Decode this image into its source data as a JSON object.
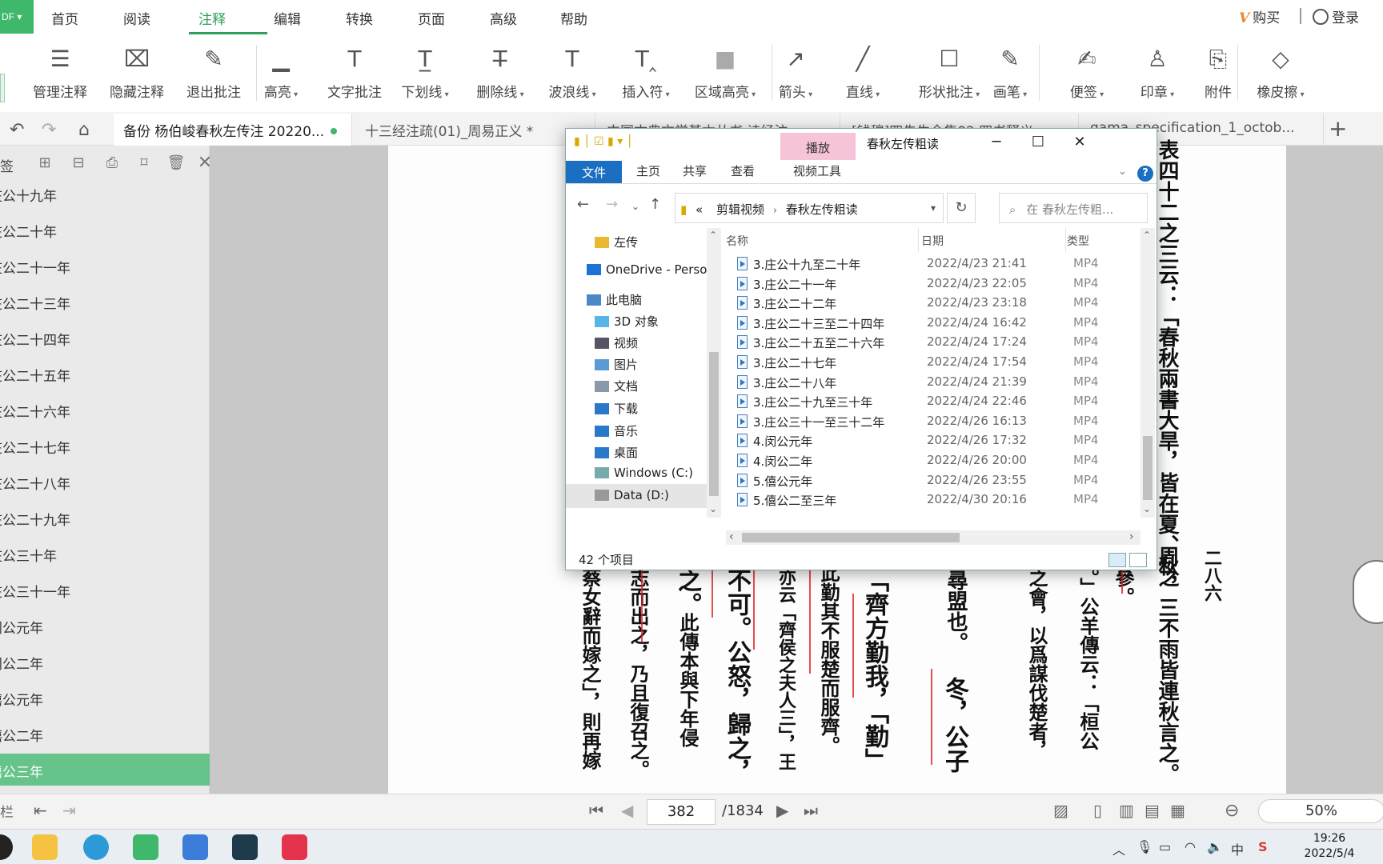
{
  "app": {
    "logo_text": "DF",
    "menu": [
      "首页",
      "阅读",
      "注释",
      "编辑",
      "转换",
      "页面",
      "高级",
      "帮助"
    ],
    "active_menu": "注释",
    "vip_label": "购买",
    "login_label": "登录"
  },
  "toolbar": {
    "items": [
      {
        "label": "管理注释",
        "caret": false,
        "icon": "manage-notes-icon"
      },
      {
        "label": "隐藏注释",
        "caret": false,
        "icon": "hide-notes-icon"
      },
      {
        "label": "退出批注",
        "caret": false,
        "icon": "exit-annotate-icon"
      },
      {
        "label": "高亮",
        "caret": true,
        "icon": "highlight-icon"
      },
      {
        "label": "文字批注",
        "caret": false,
        "icon": "text-note-icon"
      },
      {
        "label": "下划线",
        "caret": true,
        "icon": "underline-icon"
      },
      {
        "label": "删除线",
        "caret": true,
        "icon": "strikethrough-icon"
      },
      {
        "label": "波浪线",
        "caret": true,
        "icon": "wavy-line-icon"
      },
      {
        "label": "插入符",
        "caret": true,
        "icon": "caret-insert-icon"
      },
      {
        "label": "区域高亮",
        "caret": true,
        "icon": "area-highlight-icon"
      },
      {
        "label": "箭头",
        "caret": true,
        "icon": "arrow-icon"
      },
      {
        "label": "直线",
        "caret": true,
        "icon": "line-icon"
      },
      {
        "label": "形状批注",
        "caret": true,
        "icon": "shape-icon"
      },
      {
        "label": "画笔",
        "caret": true,
        "icon": "pen-icon"
      },
      {
        "label": "便签",
        "caret": true,
        "icon": "sticky-note-icon"
      },
      {
        "label": "印章",
        "caret": true,
        "icon": "stamp-icon"
      },
      {
        "label": "附件",
        "caret": false,
        "icon": "attachment-icon"
      },
      {
        "label": "橡皮擦",
        "caret": true,
        "icon": "eraser-icon"
      }
    ]
  },
  "tabs": [
    {
      "label": "备份 杨伯峻春秋左传注 20220...",
      "active": true,
      "unsaved_dot": true
    },
    {
      "label": "十三经注疏(01)_周易正义 *",
      "active": false
    },
    {
      "label": "中国古典文学基本丛书 诗经注...",
      "active": false
    },
    {
      "label": "[钱穆]四先生全集02 四书释义",
      "active": false
    },
    {
      "label": "gama_specification_1_octob...",
      "active": false
    }
  ],
  "sidebar": {
    "title": "签",
    "items": [
      "庄公十九年",
      "庄公二十年",
      "庄公二十一年",
      "庄公二十三年",
      "庄公二十四年",
      "庄公二十五年",
      "庄公二十六年",
      "庄公二十七年",
      "庄公二十八年",
      "庄公二十九年",
      "庄公三十年",
      "庄公三十一年",
      "闵公元年",
      "闵公二年",
      "僖公元年",
      "僖公二年",
      "僖公三年"
    ],
    "selected": "僖公三年"
  },
  "document": {
    "columns": [
      {
        "text": "表四十二之三云：「春秋兩書大旱，皆在夏、秋，三不雨皆連秋言之。",
        "size": 26
      },
      {
        "text": "周之",
        "size": 26
      },
      {
        "text": "二八六",
        "size": 22
      },
      {
        "text": "可參。",
        "size": 24
      },
      {
        "text": "志。」公羊傳云：「桓公",
        "size": 24
      },
      {
        "text": "殿之會，以爲謀伐楚者，",
        "size": 24
      },
      {
        "text": "求尋盟也。",
        "size": 26
      },
      {
        "text": "冬，公子",
        "size": 30
      },
      {
        "text": "「齊方勤我，「勤」",
        "size": 30
      },
      {
        "text": "此勤其不服楚而服齊。",
        "size": 24
      },
      {
        "text": "亦云「齊侯之夫人三」，王",
        "size": 22
      },
      {
        "text": "不可。公怒，歸之，",
        "size": 30
      },
      {
        "text": "此傳本與下年侵",
        "size": 24
      },
      {
        "text": "之。",
        "size": 30
      },
      {
        "text": "志而出之，乃且復召之。",
        "size": 24
      },
      {
        "text": "蔡女辭而嫁之」，則再嫁",
        "size": 24
      }
    ]
  },
  "explorer": {
    "title": "春秋左传粗读",
    "play_tab": "播放",
    "video_tools_tab": "视频工具",
    "ribbon_tabs": [
      "文件",
      "主页",
      "共享",
      "查看"
    ],
    "breadcrumb": [
      "剪辑视频",
      "春秋左传粗读"
    ],
    "breadcrumb_prefix": "«",
    "search_placeholder": "在 春秋左传粗...",
    "nav_items": [
      {
        "label": "左传",
        "icon": "folder-icon",
        "indent": 1
      },
      {
        "label": "OneDrive - Perso",
        "icon": "onedrive-icon",
        "indent": 0
      },
      {
        "label": "此电脑",
        "icon": "computer-icon",
        "indent": 0
      },
      {
        "label": "3D 对象",
        "icon": "3d-objects-icon",
        "indent": 1
      },
      {
        "label": "视频",
        "icon": "videos-icon",
        "indent": 1
      },
      {
        "label": "图片",
        "icon": "pictures-icon",
        "indent": 1
      },
      {
        "label": "文档",
        "icon": "documents-icon",
        "indent": 1
      },
      {
        "label": "下载",
        "icon": "downloads-icon",
        "indent": 1
      },
      {
        "label": "音乐",
        "icon": "music-icon",
        "indent": 1
      },
      {
        "label": "桌面",
        "icon": "desktop-icon",
        "indent": 1
      },
      {
        "label": "Windows (C:)",
        "icon": "drive-c-icon",
        "indent": 1
      },
      {
        "label": "Data (D:)",
        "icon": "drive-d-icon",
        "indent": 1,
        "selected": true
      }
    ],
    "columns": {
      "name": "名称",
      "date": "日期",
      "type": "类型"
    },
    "files": [
      {
        "name": "3.庄公十九至二十年",
        "date": "2022/4/23 21:41",
        "type": "MP4"
      },
      {
        "name": "3.庄公二十一年",
        "date": "2022/4/23 22:05",
        "type": "MP4"
      },
      {
        "name": "3.庄公二十二年",
        "date": "2022/4/23 23:18",
        "type": "MP4"
      },
      {
        "name": "3.庄公二十三至二十四年",
        "date": "2022/4/24 16:42",
        "type": "MP4"
      },
      {
        "name": "3.庄公二十五至二十六年",
        "date": "2022/4/24 17:24",
        "type": "MP4"
      },
      {
        "name": "3.庄公二十七年",
        "date": "2022/4/24 17:54",
        "type": "MP4"
      },
      {
        "name": "3.庄公二十八年",
        "date": "2022/4/24 21:39",
        "type": "MP4"
      },
      {
        "name": "3.庄公二十九至三十年",
        "date": "2022/4/24 22:46",
        "type": "MP4"
      },
      {
        "name": "3.庄公三十一至三十二年",
        "date": "2022/4/26 16:13",
        "type": "MP4"
      },
      {
        "name": "4.闵公元年",
        "date": "2022/4/26 17:32",
        "type": "MP4"
      },
      {
        "name": "4.闵公二年",
        "date": "2022/4/26 20:00",
        "type": "MP4"
      },
      {
        "name": "5.僖公元年",
        "date": "2022/4/26 23:55",
        "type": "MP4"
      },
      {
        "name": "5.僖公二至三年",
        "date": "2022/4/30 20:16",
        "type": "MP4"
      }
    ],
    "item_count": "42 个项目"
  },
  "status": {
    "current_page": "382",
    "total_pages": "/1834",
    "zoom": "50%",
    "left_label": "栏"
  },
  "taskbar": {
    "time": "19:26",
    "date": "2022/5/4",
    "ime": "中"
  },
  "colors": {
    "accent": "#2ea05a",
    "sidebar_selected": "#66c38a",
    "explorer_file_tab": "#1a6fc2",
    "play_tab": "#f6c3d8"
  }
}
